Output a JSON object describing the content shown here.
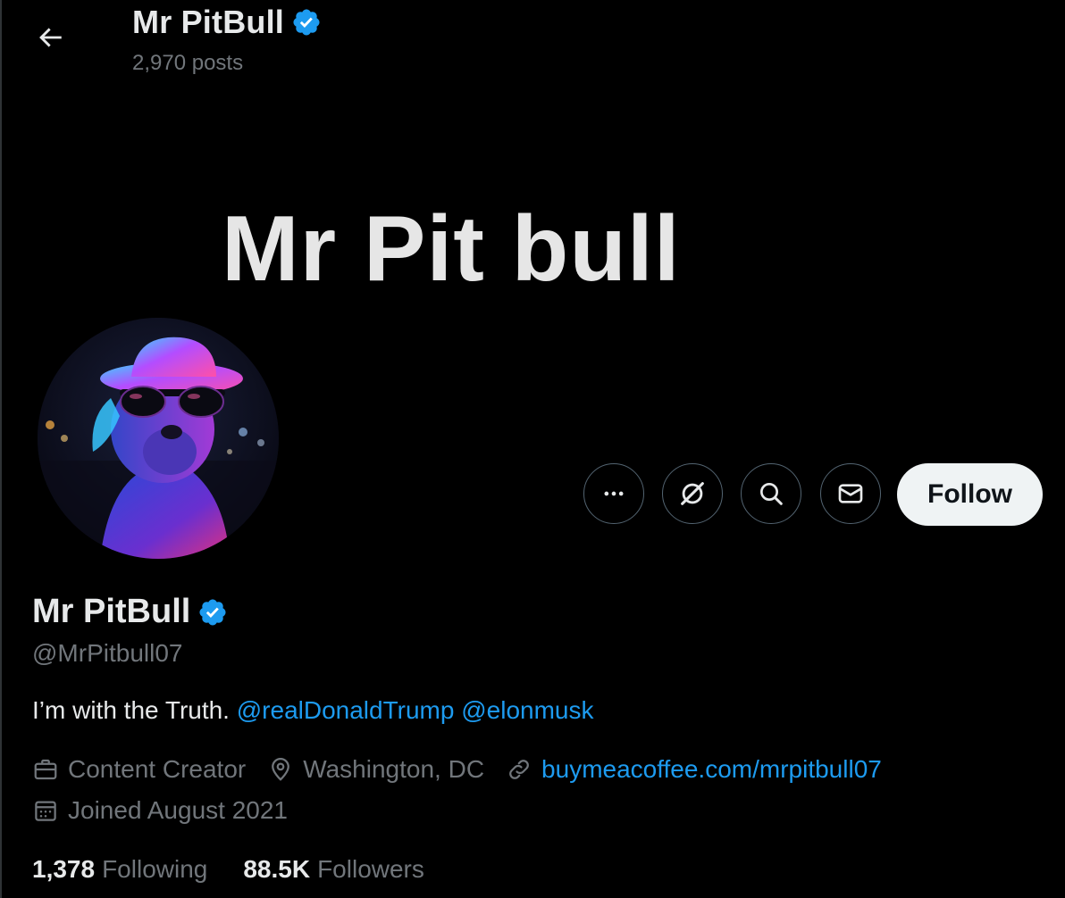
{
  "header": {
    "back_icon": "arrow-left-icon",
    "name": "Mr PitBull",
    "verified_icon": "verified-badge-icon",
    "posts_count": "2,970 posts"
  },
  "banner": {
    "text": "Mr Pit bull"
  },
  "actions": {
    "more_icon": "more-horizontal-icon",
    "grok_icon": "grok-icon",
    "search_icon": "search-icon",
    "message_icon": "mail-icon",
    "follow_label": "Follow"
  },
  "profile": {
    "name": "Mr PitBull",
    "handle": "@MrPitbull07",
    "bio_text": "I’m with the Truth.",
    "bio_mentions": [
      "@realDonaldTrump",
      "@elonmusk"
    ],
    "category": "Content Creator",
    "location": "Washington, DC",
    "website": "buymeacoffee.com/mrpitbull07",
    "joined": "Joined August 2021",
    "following_count": "1,378",
    "following_label": "Following",
    "followers_count": "88.5K",
    "followers_label": "Followers"
  },
  "colors": {
    "background": "#000000",
    "text_primary": "#e7e9ea",
    "text_secondary": "#71767b",
    "link": "#1d9bf0",
    "verified": "#1d9bf0",
    "follow_button_bg": "#eff3f4"
  }
}
